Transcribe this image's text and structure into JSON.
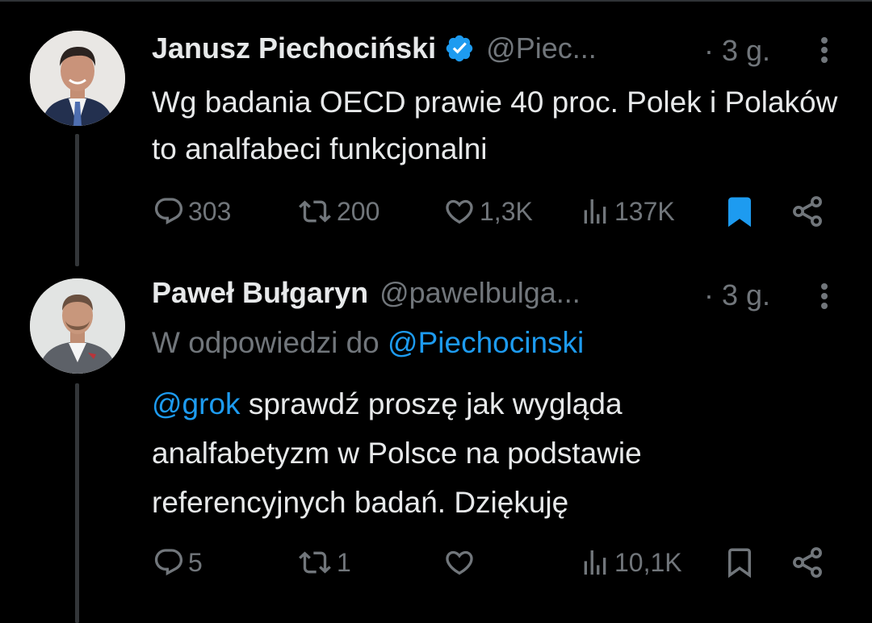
{
  "tweets": [
    {
      "author_name": "Janusz Piechociński",
      "handle": "@Piec...",
      "time": "· 3 g.",
      "text": "Wg badania OECD prawie 40 proc. Polek i Polaków to analfabeci funkcjonalni",
      "replies": "303",
      "reposts": "200",
      "likes": "1,3K",
      "views": "137K",
      "bookmarked": true
    },
    {
      "author_name": "Paweł Bułgaryn",
      "handle": "@pawelbulga...",
      "time": "· 3 g.",
      "reply_prefix": "W odpowiedzi do ",
      "reply_to": "@Piechocinski",
      "mention": "@grok",
      "text_line1_rest": " sprawdź proszę jak wygląda",
      "text_line2": "analfabetyzm w Polsce na podstawie",
      "text_line3": "referencyjnych badań. Dziękuję",
      "replies": "5",
      "reposts": "1",
      "likes": "",
      "views": "10,1K",
      "bookmarked": false
    }
  ],
  "colors": {
    "background": "#000000",
    "text": "#e7e9ea",
    "secondary": "#71767b",
    "accent": "#1d9bf0",
    "thread_line": "#333639"
  },
  "icons": [
    "verified-badge-icon",
    "more-icon",
    "reply-icon",
    "repost-icon",
    "like-icon",
    "views-icon",
    "bookmark-icon",
    "share-icon"
  ]
}
